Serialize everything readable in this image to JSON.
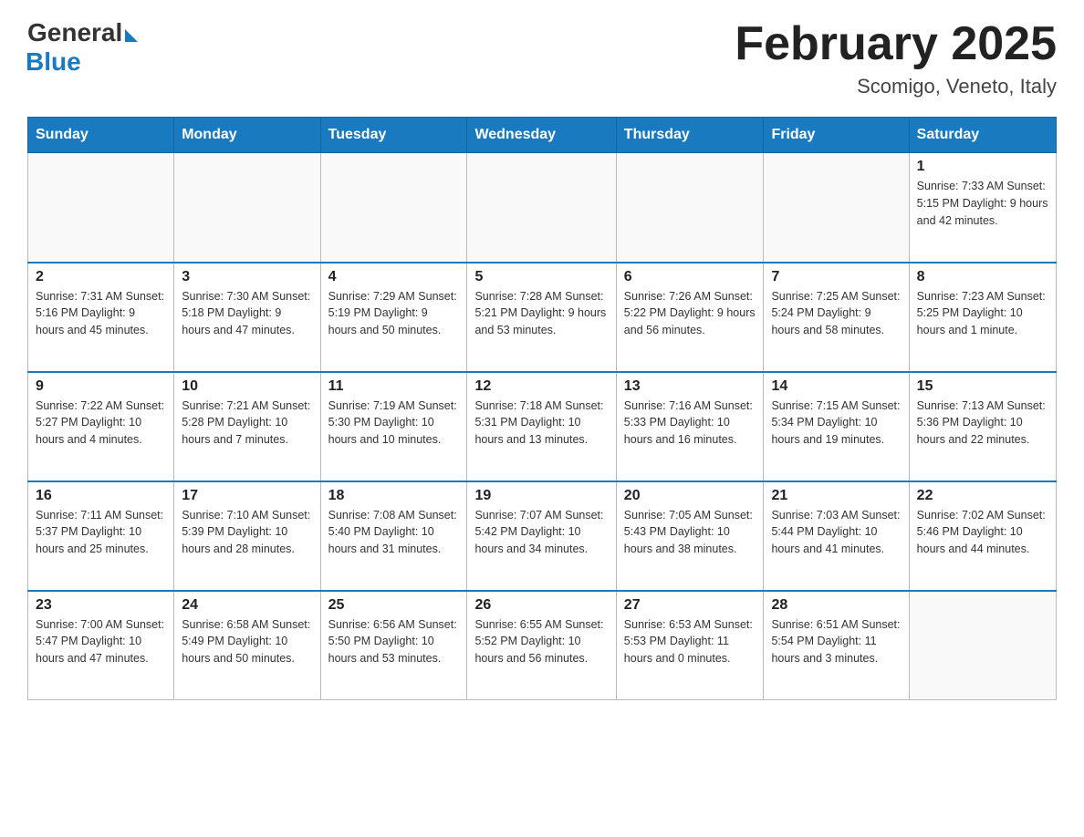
{
  "header": {
    "logo_general": "General",
    "logo_blue": "Blue",
    "month_title": "February 2025",
    "location": "Scomigo, Veneto, Italy"
  },
  "days_of_week": [
    "Sunday",
    "Monday",
    "Tuesday",
    "Wednesday",
    "Thursday",
    "Friday",
    "Saturday"
  ],
  "weeks": [
    [
      {
        "day": "",
        "info": ""
      },
      {
        "day": "",
        "info": ""
      },
      {
        "day": "",
        "info": ""
      },
      {
        "day": "",
        "info": ""
      },
      {
        "day": "",
        "info": ""
      },
      {
        "day": "",
        "info": ""
      },
      {
        "day": "1",
        "info": "Sunrise: 7:33 AM\nSunset: 5:15 PM\nDaylight: 9 hours and 42 minutes."
      }
    ],
    [
      {
        "day": "2",
        "info": "Sunrise: 7:31 AM\nSunset: 5:16 PM\nDaylight: 9 hours and 45 minutes."
      },
      {
        "day": "3",
        "info": "Sunrise: 7:30 AM\nSunset: 5:18 PM\nDaylight: 9 hours and 47 minutes."
      },
      {
        "day": "4",
        "info": "Sunrise: 7:29 AM\nSunset: 5:19 PM\nDaylight: 9 hours and 50 minutes."
      },
      {
        "day": "5",
        "info": "Sunrise: 7:28 AM\nSunset: 5:21 PM\nDaylight: 9 hours and 53 minutes."
      },
      {
        "day": "6",
        "info": "Sunrise: 7:26 AM\nSunset: 5:22 PM\nDaylight: 9 hours and 56 minutes."
      },
      {
        "day": "7",
        "info": "Sunrise: 7:25 AM\nSunset: 5:24 PM\nDaylight: 9 hours and 58 minutes."
      },
      {
        "day": "8",
        "info": "Sunrise: 7:23 AM\nSunset: 5:25 PM\nDaylight: 10 hours and 1 minute."
      }
    ],
    [
      {
        "day": "9",
        "info": "Sunrise: 7:22 AM\nSunset: 5:27 PM\nDaylight: 10 hours and 4 minutes."
      },
      {
        "day": "10",
        "info": "Sunrise: 7:21 AM\nSunset: 5:28 PM\nDaylight: 10 hours and 7 minutes."
      },
      {
        "day": "11",
        "info": "Sunrise: 7:19 AM\nSunset: 5:30 PM\nDaylight: 10 hours and 10 minutes."
      },
      {
        "day": "12",
        "info": "Sunrise: 7:18 AM\nSunset: 5:31 PM\nDaylight: 10 hours and 13 minutes."
      },
      {
        "day": "13",
        "info": "Sunrise: 7:16 AM\nSunset: 5:33 PM\nDaylight: 10 hours and 16 minutes."
      },
      {
        "day": "14",
        "info": "Sunrise: 7:15 AM\nSunset: 5:34 PM\nDaylight: 10 hours and 19 minutes."
      },
      {
        "day": "15",
        "info": "Sunrise: 7:13 AM\nSunset: 5:36 PM\nDaylight: 10 hours and 22 minutes."
      }
    ],
    [
      {
        "day": "16",
        "info": "Sunrise: 7:11 AM\nSunset: 5:37 PM\nDaylight: 10 hours and 25 minutes."
      },
      {
        "day": "17",
        "info": "Sunrise: 7:10 AM\nSunset: 5:39 PM\nDaylight: 10 hours and 28 minutes."
      },
      {
        "day": "18",
        "info": "Sunrise: 7:08 AM\nSunset: 5:40 PM\nDaylight: 10 hours and 31 minutes."
      },
      {
        "day": "19",
        "info": "Sunrise: 7:07 AM\nSunset: 5:42 PM\nDaylight: 10 hours and 34 minutes."
      },
      {
        "day": "20",
        "info": "Sunrise: 7:05 AM\nSunset: 5:43 PM\nDaylight: 10 hours and 38 minutes."
      },
      {
        "day": "21",
        "info": "Sunrise: 7:03 AM\nSunset: 5:44 PM\nDaylight: 10 hours and 41 minutes."
      },
      {
        "day": "22",
        "info": "Sunrise: 7:02 AM\nSunset: 5:46 PM\nDaylight: 10 hours and 44 minutes."
      }
    ],
    [
      {
        "day": "23",
        "info": "Sunrise: 7:00 AM\nSunset: 5:47 PM\nDaylight: 10 hours and 47 minutes."
      },
      {
        "day": "24",
        "info": "Sunrise: 6:58 AM\nSunset: 5:49 PM\nDaylight: 10 hours and 50 minutes."
      },
      {
        "day": "25",
        "info": "Sunrise: 6:56 AM\nSunset: 5:50 PM\nDaylight: 10 hours and 53 minutes."
      },
      {
        "day": "26",
        "info": "Sunrise: 6:55 AM\nSunset: 5:52 PM\nDaylight: 10 hours and 56 minutes."
      },
      {
        "day": "27",
        "info": "Sunrise: 6:53 AM\nSunset: 5:53 PM\nDaylight: 11 hours and 0 minutes."
      },
      {
        "day": "28",
        "info": "Sunrise: 6:51 AM\nSunset: 5:54 PM\nDaylight: 11 hours and 3 minutes."
      },
      {
        "day": "",
        "info": ""
      }
    ]
  ]
}
